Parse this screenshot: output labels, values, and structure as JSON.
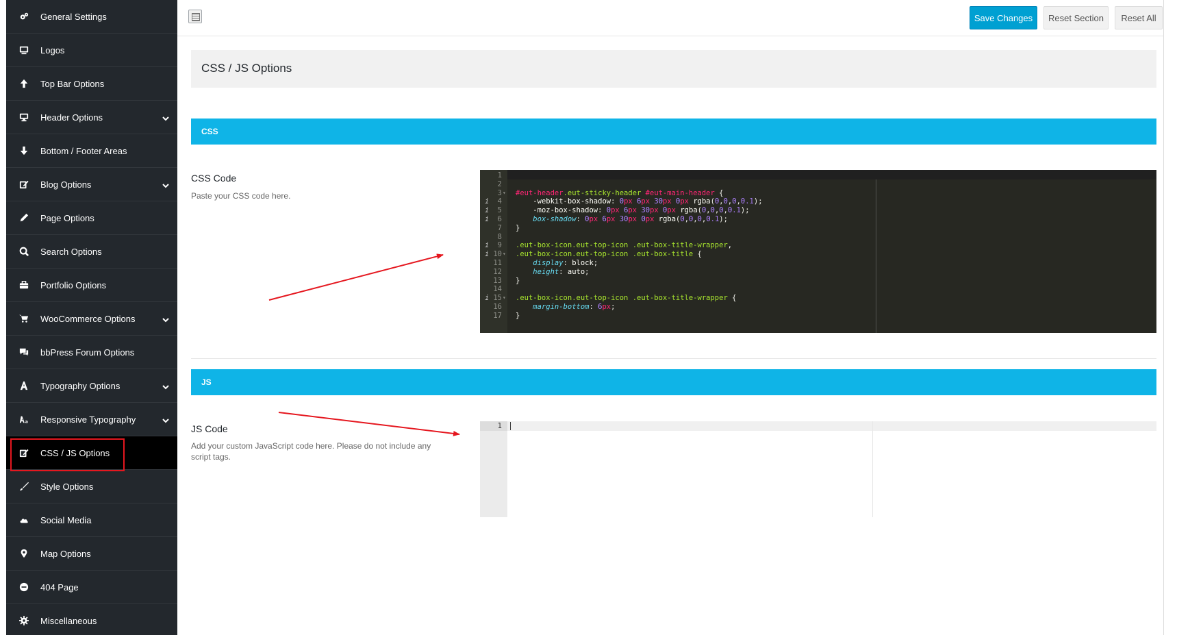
{
  "sidebar": {
    "items": [
      {
        "label": "General Settings",
        "icon": "gears-icon",
        "has_submenu": false
      },
      {
        "label": "Logos",
        "icon": "monitor-icon",
        "has_submenu": false
      },
      {
        "label": "Top Bar Options",
        "icon": "arrow-up-icon",
        "has_submenu": false
      },
      {
        "label": "Header Options",
        "icon": "desktop-icon",
        "has_submenu": true
      },
      {
        "label": "Bottom / Footer Areas",
        "icon": "arrow-down-icon",
        "has_submenu": false
      },
      {
        "label": "Blog Options",
        "icon": "edit-icon",
        "has_submenu": true
      },
      {
        "label": "Page Options",
        "icon": "pencil-icon",
        "has_submenu": false
      },
      {
        "label": "Search Options",
        "icon": "search-icon",
        "has_submenu": false
      },
      {
        "label": "Portfolio Options",
        "icon": "briefcase-icon",
        "has_submenu": false
      },
      {
        "label": "WooCommerce Options",
        "icon": "cart-icon",
        "has_submenu": true
      },
      {
        "label": "bbPress Forum Options",
        "icon": "comments-icon",
        "has_submenu": false
      },
      {
        "label": "Typography Options",
        "icon": "font-icon",
        "has_submenu": true
      },
      {
        "label": "Responsive Typography",
        "icon": "text-size-icon",
        "has_submenu": true
      },
      {
        "label": "CSS / JS Options",
        "icon": "edit-icon",
        "has_submenu": false,
        "active": true
      },
      {
        "label": "Style Options",
        "icon": "brush-icon",
        "has_submenu": false
      },
      {
        "label": "Social Media",
        "icon": "cloud-icon",
        "has_submenu": false
      },
      {
        "label": "Map Options",
        "icon": "map-marker-icon",
        "has_submenu": false
      },
      {
        "label": "404 Page",
        "icon": "minus-circle-icon",
        "has_submenu": false
      },
      {
        "label": "Miscellaneous",
        "icon": "gear-icon",
        "has_submenu": false
      }
    ]
  },
  "topbar": {
    "save_label": "Save Changes",
    "reset_section_label": "Reset Section",
    "reset_all_label": "Reset All"
  },
  "page": {
    "title": "CSS / JS Options"
  },
  "sections": {
    "css": {
      "heading": "CSS",
      "field_label": "CSS Code",
      "field_desc": "Paste your CSS code here."
    },
    "js": {
      "heading": "JS",
      "field_label": "JS Code",
      "field_desc": "Add your custom JavaScript code here. Please do not include any script tags."
    }
  },
  "css_editor": {
    "lines": [
      {
        "n": "1",
        "info": false,
        "fold": false,
        "code": ""
      },
      {
        "n": "2",
        "info": false,
        "fold": false,
        "code": ""
      },
      {
        "n": "3",
        "info": false,
        "fold": true,
        "code": "#eut-header.eut-sticky-header #eut-main-header {"
      },
      {
        "n": "4",
        "info": true,
        "fold": false,
        "code": "    -webkit-box-shadow: 0px 6px 30px 0px rgba(0,0,0,0.1);"
      },
      {
        "n": "5",
        "info": true,
        "fold": false,
        "code": "    -moz-box-shadow: 0px 6px 30px 0px rgba(0,0,0,0.1);"
      },
      {
        "n": "6",
        "info": true,
        "fold": false,
        "code": "    box-shadow: 0px 6px 30px 0px rgba(0,0,0,0.1);"
      },
      {
        "n": "7",
        "info": false,
        "fold": false,
        "code": "}"
      },
      {
        "n": "8",
        "info": false,
        "fold": false,
        "code": ""
      },
      {
        "n": "9",
        "info": true,
        "fold": false,
        "code": ".eut-box-icon.eut-top-icon .eut-box-title-wrapper,"
      },
      {
        "n": "10",
        "info": true,
        "fold": true,
        "code": ".eut-box-icon.eut-top-icon .eut-box-title {"
      },
      {
        "n": "11",
        "info": false,
        "fold": false,
        "code": "    display: block;"
      },
      {
        "n": "12",
        "info": false,
        "fold": false,
        "code": "    height: auto;"
      },
      {
        "n": "13",
        "info": false,
        "fold": false,
        "code": "}"
      },
      {
        "n": "14",
        "info": false,
        "fold": false,
        "code": ""
      },
      {
        "n": "15",
        "info": true,
        "fold": true,
        "code": ".eut-box-icon.eut-top-icon .eut-box-title-wrapper {"
      },
      {
        "n": "16",
        "info": false,
        "fold": false,
        "code": "    margin-bottom: 6px;"
      },
      {
        "n": "17",
        "info": false,
        "fold": false,
        "code": "}"
      }
    ]
  },
  "js_editor": {
    "lines": [
      {
        "n": "1",
        "code": ""
      }
    ]
  },
  "colors": {
    "sidebar_bg": "#23282d",
    "section_bar": "#0fb4e7",
    "save_button": "#00a0d2",
    "annotation_red": "#e5171f",
    "editor_bg": "#272822"
  }
}
